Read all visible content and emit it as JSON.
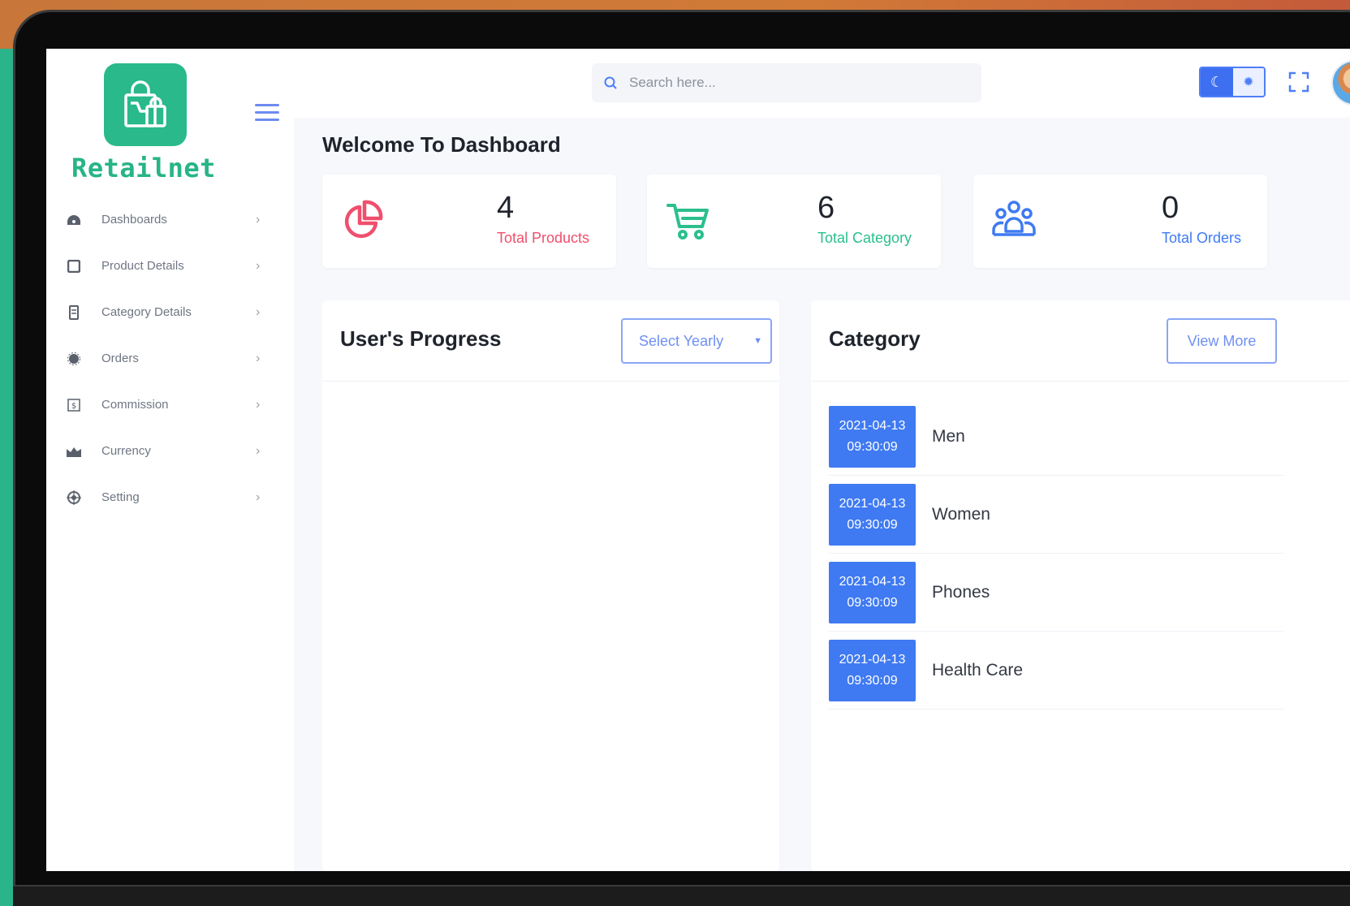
{
  "app": {
    "brand": "Retailnet",
    "accent": "#29b98a",
    "primary": "#3f7af2"
  },
  "search": {
    "placeholder": "Search here..."
  },
  "sidebar": {
    "items": [
      {
        "label": "Dashboards",
        "icon": "dashboard-icon"
      },
      {
        "label": "Product Details",
        "icon": "product-icon"
      },
      {
        "label": "Category Details",
        "icon": "category-icon"
      },
      {
        "label": "Orders",
        "icon": "orders-icon"
      },
      {
        "label": "Commission",
        "icon": "commission-icon"
      },
      {
        "label": "Currency",
        "icon": "currency-icon"
      },
      {
        "label": "Setting",
        "icon": "setting-icon"
      }
    ]
  },
  "main": {
    "welcome": "Welcome To Dashboard",
    "stats": [
      {
        "value": "4",
        "label": "Total Products",
        "color": "#ef4f6d",
        "icon": "pie-chart-icon"
      },
      {
        "value": "6",
        "label": "Total Category",
        "color": "#2bbf8c",
        "icon": "cart-icon"
      },
      {
        "value": "0",
        "label": "Total Orders",
        "color": "#3f7af2",
        "icon": "users-icon"
      }
    ],
    "progress": {
      "title": "User's Progress",
      "select_value": "Select Yearly"
    },
    "category": {
      "title": "Category",
      "view_more": "View More",
      "items": [
        {
          "date": "2021-04-13",
          "time": "09:30:09",
          "name": "Men"
        },
        {
          "date": "2021-04-13",
          "time": "09:30:09",
          "name": "Women"
        },
        {
          "date": "2021-04-13",
          "time": "09:30:09",
          "name": "Phones"
        },
        {
          "date": "2021-04-13",
          "time": "09:30:09",
          "name": "Health Care"
        }
      ]
    }
  }
}
